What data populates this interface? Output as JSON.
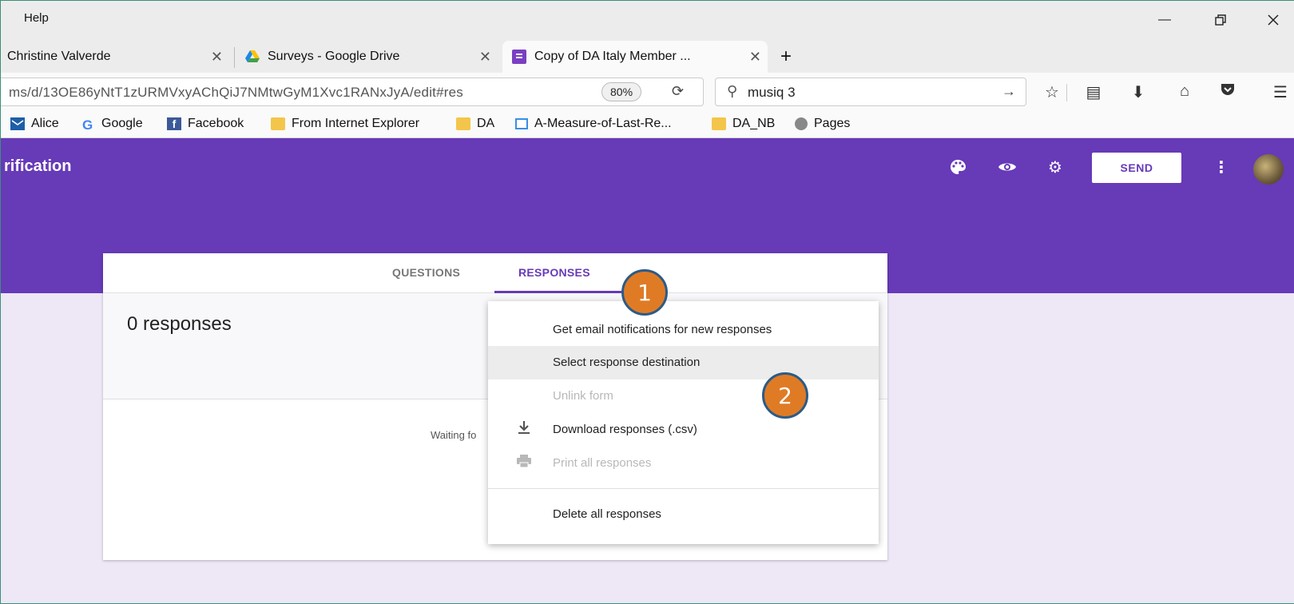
{
  "window": {
    "menu_help": "Help",
    "minimize_icon": "minimize-icon",
    "restore_icon": "restore-icon",
    "close_icon": "close-icon"
  },
  "tabs": [
    {
      "label": "Christine Valverde",
      "icon": "tab-icon"
    },
    {
      "label": "Surveys - Google Drive",
      "icon": "google-drive-icon"
    },
    {
      "label": "Copy of DA Italy Member ...",
      "icon": "google-forms-icon",
      "active": true
    }
  ],
  "new_tab_label": "+",
  "nav": {
    "url": "ms/d/13OE86yNtT1zURMVxyAChQiJ7NMtwGyM1Xvc1RANxJyA/edit#res",
    "zoom": "80%",
    "search_value": "musiq 3"
  },
  "bookmarks": [
    {
      "label": "Alice",
      "icon": "mail-icon"
    },
    {
      "label": "Google",
      "icon": "google-icon"
    },
    {
      "label": "Facebook",
      "icon": "facebook-icon"
    },
    {
      "label": "From Internet Explorer",
      "icon": "folder-icon"
    },
    {
      "label": "DA",
      "icon": "folder-icon"
    },
    {
      "label": "A-Measure-of-Last-Re...",
      "icon": "page-icon"
    },
    {
      "label": "DA_NB",
      "icon": "folder-icon"
    },
    {
      "label": "Pages",
      "icon": "globe-icon"
    }
  ],
  "app": {
    "title": "rification",
    "send_label": "SEND",
    "accent": "#673ab7"
  },
  "form": {
    "tab_questions": "QUESTIONS",
    "tab_responses": "RESPONSES",
    "responses_count": "0 responses",
    "waiting_text": "Waiting fo"
  },
  "menu": {
    "items": [
      {
        "label": "Get email notifications for new responses",
        "icon": "",
        "state": "normal"
      },
      {
        "label": "Select response destination",
        "icon": "",
        "state": "highlighted"
      },
      {
        "label": "Unlink form",
        "icon": "",
        "state": "disabled"
      },
      {
        "label": "Download responses (.csv)",
        "icon": "download-icon",
        "state": "normal"
      },
      {
        "label": "Print all responses",
        "icon": "print-icon",
        "state": "disabled"
      },
      {
        "label": "Delete all responses",
        "icon": "",
        "state": "normal"
      }
    ]
  },
  "callouts": [
    "1",
    "2"
  ]
}
